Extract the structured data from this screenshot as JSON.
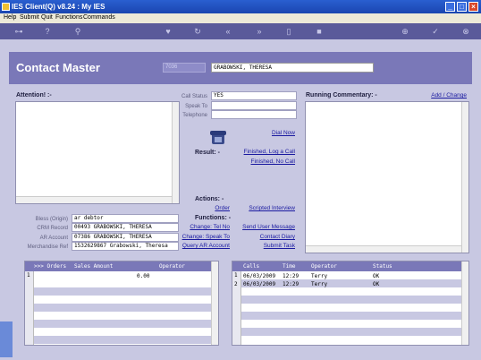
{
  "window": {
    "title": "IES Client(Q) v8.24 : My IES"
  },
  "menu": [
    "Help",
    "Submit",
    "Quit",
    "Functions",
    "Commands"
  ],
  "header": {
    "title": "Contact Master",
    "code": "7036",
    "name": "GRABOWSKI, THERESA"
  },
  "attention_label": "Attention! :-",
  "running_commentary_label": "Running Commentary: -",
  "add_change_link": "Add / Change",
  "call_fields": [
    {
      "label": "Call Status",
      "value": "YES"
    },
    {
      "label": "Speak To",
      "value": ""
    },
    {
      "label": "Telephone",
      "value": ""
    }
  ],
  "dial_now": "Dial Now",
  "result_label": "Result: -",
  "result_links": [
    "Finished, Log a Call",
    "Finished, No Call"
  ],
  "actions_label": "Actions: -",
  "action_links": [
    "Order",
    "Scripted Interview"
  ],
  "functions_label": "Functions: -",
  "function_links": [
    [
      "Change: Tel No",
      "Send User Message"
    ],
    [
      "Change: Speak To",
      "Contact Diary"
    ],
    [
      "Query AR Account",
      "Submit Task"
    ]
  ],
  "entity_fields": [
    {
      "label": "Bless (Origin)",
      "value": "ar debtor"
    },
    {
      "label": "CRM Record",
      "value": "00493 GRABOWSKI, THERESA"
    },
    {
      "label": "AR Account",
      "value": "07386 GRABOWSKI, THERESA"
    },
    {
      "label": "Merchandise Ref",
      "value": "1532629867 Grabowski, Theresa"
    }
  ],
  "orders_grid": {
    "headers": [
      ">>> Orders",
      "Sales Amount",
      "Operator"
    ],
    "rows": [
      {
        "num": "1",
        "orders": "",
        "amount": "0.00",
        "operator": ""
      }
    ]
  },
  "calls_grid": {
    "headers": [
      "Calls",
      "Time",
      "Operator",
      "Status"
    ],
    "rows": [
      {
        "num": "1",
        "date": "06/03/2009",
        "time": "12:29",
        "operator": "Terry",
        "status": "OK"
      },
      {
        "num": "2",
        "date": "06/03/2009",
        "time": "12:29",
        "operator": "Terry",
        "status": "OK"
      }
    ]
  }
}
